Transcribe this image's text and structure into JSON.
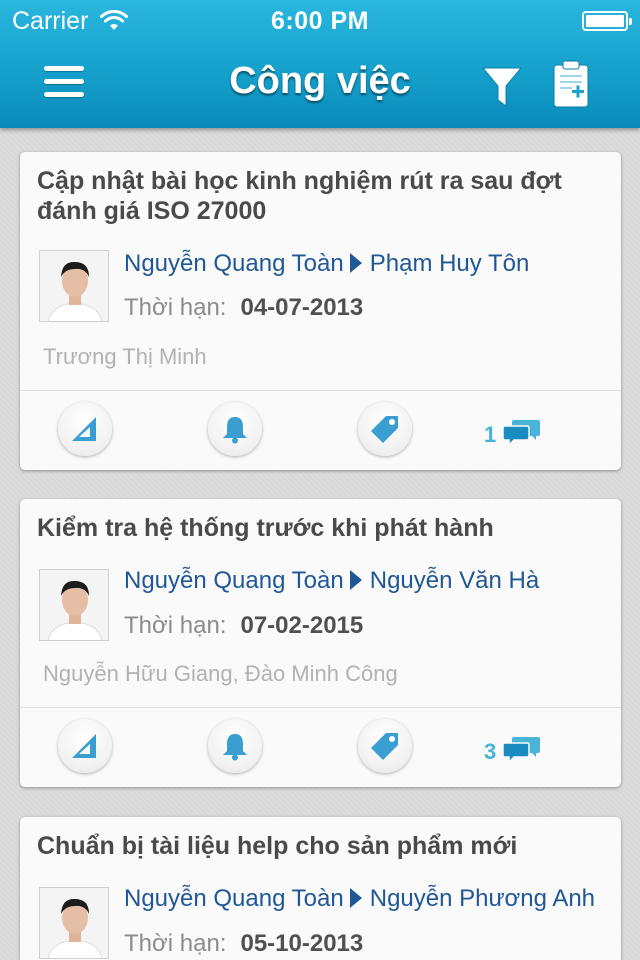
{
  "status_bar": {
    "carrier": "Carrier",
    "time": "6:00 PM"
  },
  "header": {
    "title": "Công việc"
  },
  "icons": {
    "menu": "hamburger-menu-icon",
    "filter": "filter-funnel-icon",
    "add": "clipboard-add-icon",
    "edit": "set-square-ruler-icon",
    "reminder": "bell-icon",
    "tag": "tag-icon",
    "comments": "chat-bubbles-icon"
  },
  "colors": {
    "header": "#149fcb",
    "link": "#1f5797",
    "accent": "#4ab3d8"
  },
  "tasks": [
    {
      "title": "Cập nhật bài học kinh nghiệm rút ra sau đợt đánh giá ISO 27000",
      "assigner": "Nguyễn Quang Toàn",
      "assignee": "Phạm Huy Tôn",
      "deadline_label": "Thời hạn:",
      "deadline": "04-07-2013",
      "participants": "Trương Thị Minh",
      "comments": "1"
    },
    {
      "title": "Kiểm tra hệ thống trước khi phát hành",
      "assigner": "Nguyễn Quang Toàn",
      "assignee": "Nguyễn Văn Hà",
      "deadline_label": "Thời hạn:",
      "deadline": "07-02-2015",
      "participants": "Nguyễn Hữu Giang, Đào Minh Công",
      "comments": "3"
    },
    {
      "title": "Chuẩn bị tài liệu help cho sản phẩm mới",
      "assigner": "Nguyễn Quang Toàn",
      "assignee": "Nguyễn Phương Anh",
      "deadline_label": "Thời hạn:",
      "deadline": "05-10-2013"
    }
  ]
}
